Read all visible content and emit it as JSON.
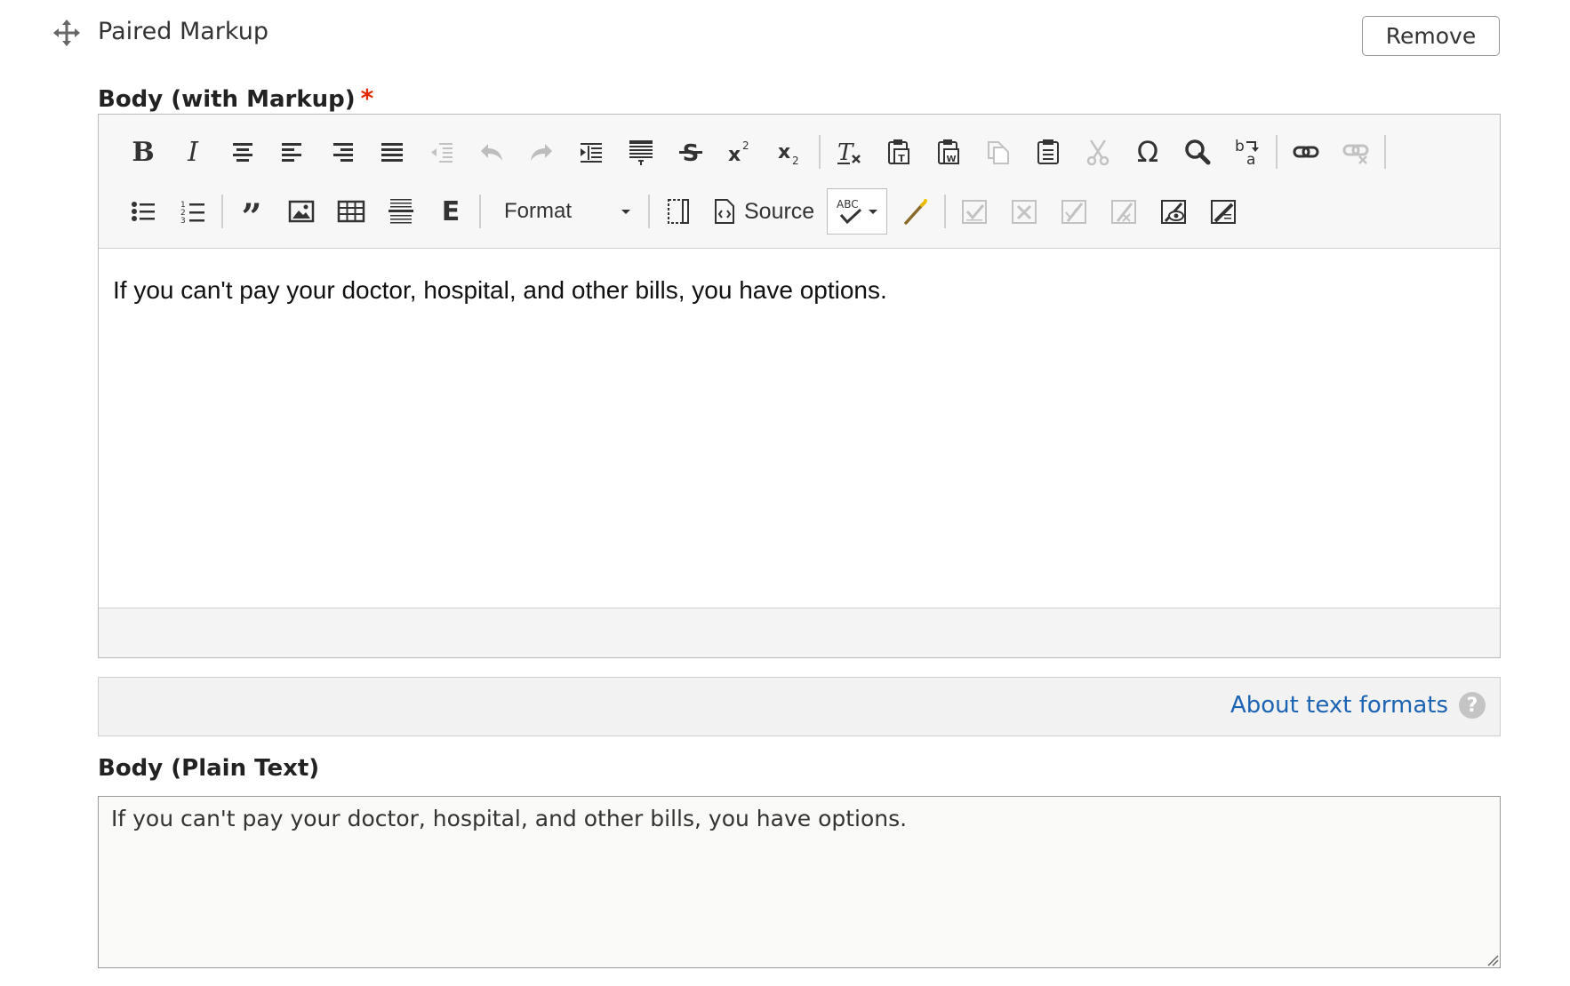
{
  "section": {
    "title": "Paired Markup",
    "remove_label": "Remove"
  },
  "markup_field": {
    "label": "Body (with Markup)",
    "required_marker": "*",
    "content": "If you can't pay your doctor, hospital, and other bills, you have options."
  },
  "toolbar": {
    "format_label": "Format",
    "source_label": "Source",
    "spell_label": "ABC",
    "row1_icons": [
      "bold-icon",
      "italic-icon",
      "align-center-icon",
      "align-left-icon",
      "align-right-icon",
      "align-justify-icon",
      "outdent-icon",
      "undo-icon",
      "redo-icon",
      "indent-icon",
      "show-blocks-icon",
      "strikethrough-icon",
      "superscript-icon",
      "subscript-icon",
      "remove-format-icon",
      "paste-text-icon",
      "paste-word-icon",
      "copy-icon",
      "paste-icon",
      "cut-icon",
      "special-char-icon",
      "find-icon",
      "replace-icon",
      "link-icon",
      "unlink-icon"
    ],
    "row2_icons": [
      "bulleted-list-icon",
      "numbered-list-icon",
      "blockquote-icon",
      "image-icon",
      "table-icon",
      "horizontal-rule-icon",
      "embed-icon",
      "format-dropdown",
      "templates-icon",
      "source-icon",
      "spellcheck-icon",
      "magic-wand-icon",
      "accept-change-icon",
      "reject-change-icon",
      "accept-all-icon",
      "reject-all-icon",
      "show-changes-icon",
      "track-changes-icon"
    ]
  },
  "text_formats": {
    "link_label": "About text formats",
    "help_glyph": "?"
  },
  "plain_field": {
    "label": "Body (Plain Text)",
    "value": "If you can't pay your doctor, hospital, and other bills, you have options."
  },
  "colors": {
    "link": "#1b63b3",
    "required": "#e32700",
    "toolbar_bg": "#f7f7f7",
    "disabled_icon": "#b8b8b8"
  }
}
